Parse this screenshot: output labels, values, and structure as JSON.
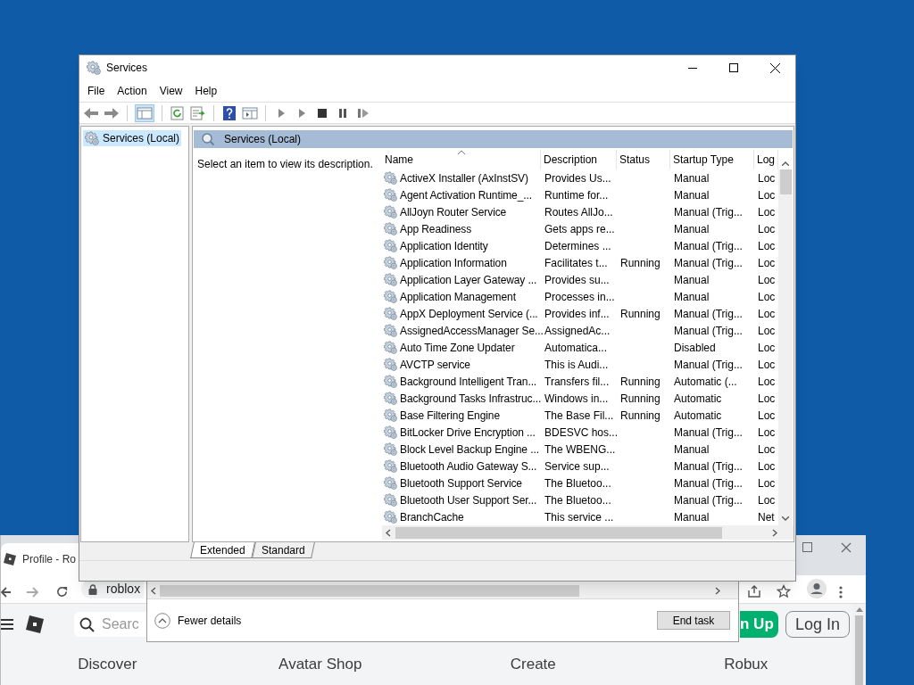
{
  "browser": {
    "tab_title": "Profile - Ro",
    "address": "roblox",
    "search_placeholder": "Searc",
    "sign_up": "n Up",
    "log_in": "Log In",
    "nav": [
      "Discover",
      "Avatar Shop",
      "Create",
      "Robux"
    ]
  },
  "task_manager": {
    "toggle": "Fewer details",
    "end_task": "End task"
  },
  "services_window": {
    "title": "Services",
    "menu": [
      "File",
      "Action",
      "View",
      "Help"
    ],
    "tree": [
      {
        "label": "Services (Local)",
        "selected": true
      }
    ],
    "pane_title": "Services (Local)",
    "description_hint": "Select an item to view its description.",
    "table": {
      "columns": [
        {
          "label": "Name",
          "sorted": true
        },
        {
          "label": "Description",
          "sorted": false
        },
        {
          "label": "Status",
          "sorted": false
        },
        {
          "label": "Startup Type",
          "sorted": false
        },
        {
          "label": "Log",
          "sorted": false
        }
      ],
      "rows": [
        {
          "name": "ActiveX Installer (AxInstSV)",
          "description": "Provides Us...",
          "startup": "Manual",
          "log": "Loc"
        },
        {
          "name": "Agent Activation Runtime_...",
          "description": "Runtime for...",
          "startup": "Manual",
          "log": "Loc"
        },
        {
          "name": "AllJoyn Router Service",
          "description": "Routes AllJo...",
          "startup": "Manual (Trig...",
          "log": "Loc"
        },
        {
          "name": "App Readiness",
          "description": "Gets apps re...",
          "startup": "Manual",
          "log": "Loc"
        },
        {
          "name": "Application Identity",
          "description": "Determines ...",
          "startup": "Manual (Trig...",
          "log": "Loc"
        },
        {
          "name": "Application Information",
          "description": "Facilitates t...",
          "status": "Running",
          "startup": "Manual (Trig...",
          "log": "Loc"
        },
        {
          "name": "Application Layer Gateway ...",
          "description": "Provides su...",
          "startup": "Manual",
          "log": "Loc"
        },
        {
          "name": "Application Management",
          "description": "Processes in...",
          "startup": "Manual",
          "log": "Loc"
        },
        {
          "name": "AppX Deployment Service (...",
          "description": "Provides inf...",
          "status": "Running",
          "startup": "Manual (Trig...",
          "log": "Loc"
        },
        {
          "name": "AssignedAccessManager Se...",
          "description": "AssignedAc...",
          "startup": "Manual (Trig...",
          "log": "Loc"
        },
        {
          "name": "Auto Time Zone Updater",
          "description": "Automatica...",
          "startup": "Disabled",
          "log": "Loc"
        },
        {
          "name": "AVCTP service",
          "description": "This is Audi...",
          "startup": "Manual (Trig...",
          "log": "Loc"
        },
        {
          "name": "Background Intelligent Tran...",
          "description": "Transfers fil...",
          "status": "Running",
          "startup": "Automatic (...",
          "log": "Loc"
        },
        {
          "name": "Background Tasks Infrastruc...",
          "description": "Windows in...",
          "status": "Running",
          "startup": "Automatic",
          "log": "Loc"
        },
        {
          "name": "Base Filtering Engine",
          "description": "The Base Fil...",
          "status": "Running",
          "startup": "Automatic",
          "log": "Loc"
        },
        {
          "name": "BitLocker Drive Encryption ...",
          "description": "BDESVC hos...",
          "startup": "Manual (Trig...",
          "log": "Loc"
        },
        {
          "name": "Block Level Backup Engine ...",
          "description": "The WBENG...",
          "startup": "Manual",
          "log": "Loc"
        },
        {
          "name": "Bluetooth Audio Gateway S...",
          "description": "Service sup...",
          "startup": "Manual (Trig...",
          "log": "Loc"
        },
        {
          "name": "Bluetooth Support Service",
          "description": "The Bluetoo...",
          "startup": "Manual (Trig...",
          "log": "Loc"
        },
        {
          "name": "Bluetooth User Support Ser...",
          "description": "The Bluetoo...",
          "startup": "Manual (Trig...",
          "log": "Loc"
        },
        {
          "name": "BranchCache",
          "description": "This service ...",
          "startup": "Manual",
          "log": "Net"
        }
      ]
    },
    "tabs": [
      {
        "label": "Extended",
        "selected": true
      },
      {
        "label": "Standard",
        "selected": false
      }
    ]
  }
}
